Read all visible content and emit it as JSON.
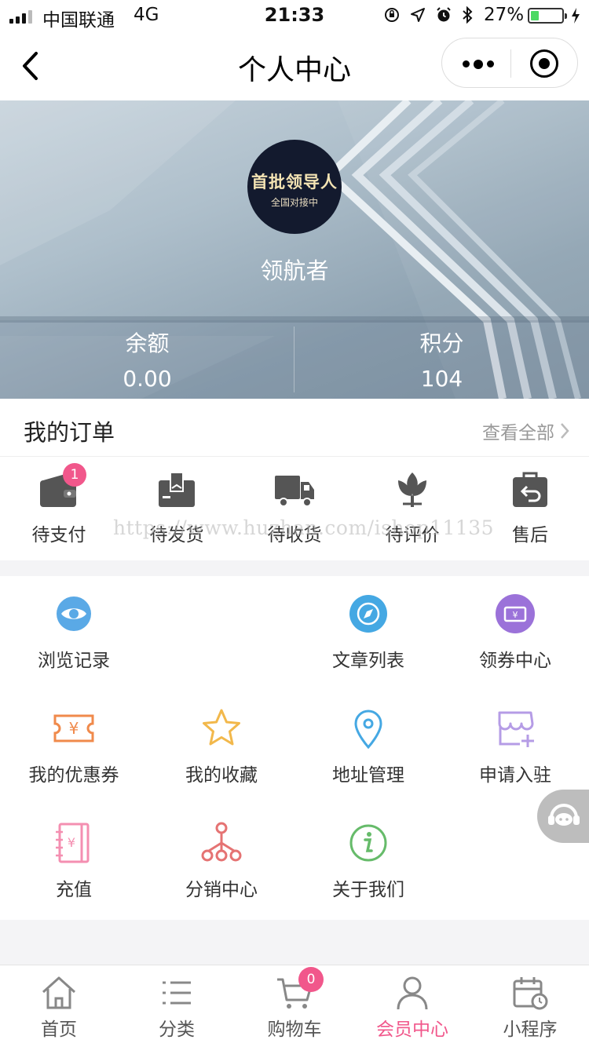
{
  "status_bar": {
    "carrier": "中国联通",
    "network": "4G",
    "time": "21:33",
    "battery_percent": "27%",
    "battery_level": 0.27
  },
  "nav": {
    "title": "个人中心"
  },
  "profile": {
    "avatar_text_line1": "首批领导人",
    "avatar_text_line2": "全国对接中",
    "nickname": "领航者",
    "balance_label": "余额",
    "balance_value": "0.00",
    "points_label": "积分",
    "points_value": "104"
  },
  "orders": {
    "title": "我的订单",
    "view_all": "查看全部",
    "items": [
      {
        "label": "待支付",
        "icon": "wallet-icon",
        "badge": "1"
      },
      {
        "label": "待发货",
        "icon": "box-icon"
      },
      {
        "label": "待收货",
        "icon": "truck-icon"
      },
      {
        "label": "待评价",
        "icon": "flower-icon"
      },
      {
        "label": "售后",
        "icon": "return-bag-icon"
      }
    ],
    "watermark": "https://www.huzhan.com/ishop11135"
  },
  "services": [
    {
      "label": "浏览记录",
      "icon": "eye-icon",
      "color": "#5aa9e6"
    },
    {
      "label": "文章列表",
      "icon": "compass-icon",
      "color": "#45a8e3"
    },
    {
      "label": "领券中心",
      "icon": "coupon-center-icon",
      "color": "#9b72d9"
    },
    {
      "label": "我的优惠券",
      "icon": "coupon-icon",
      "color": "#f08a4b"
    },
    {
      "label": "我的收藏",
      "icon": "star-icon",
      "color": "#f2b84b"
    },
    {
      "label": "地址管理",
      "icon": "location-icon",
      "color": "#45a8e3"
    },
    {
      "label": "申请入驻",
      "icon": "shop-apply-icon",
      "color": "#b59ce6"
    },
    {
      "label": "充值",
      "icon": "recharge-icon",
      "color": "#f48fb1"
    },
    {
      "label": "分销中心",
      "icon": "distribution-icon",
      "color": "#e57373"
    },
    {
      "label": "关于我们",
      "icon": "info-icon",
      "color": "#66bb6a"
    }
  ],
  "tabbar": {
    "items": [
      {
        "label": "首页",
        "icon": "home-icon"
      },
      {
        "label": "分类",
        "icon": "category-icon"
      },
      {
        "label": "购物车",
        "icon": "cart-icon",
        "badge": "0"
      },
      {
        "label": "会员中心",
        "icon": "member-icon",
        "active": true
      },
      {
        "label": "小程序",
        "icon": "calendar-icon"
      }
    ],
    "active_color": "#f1578b"
  }
}
